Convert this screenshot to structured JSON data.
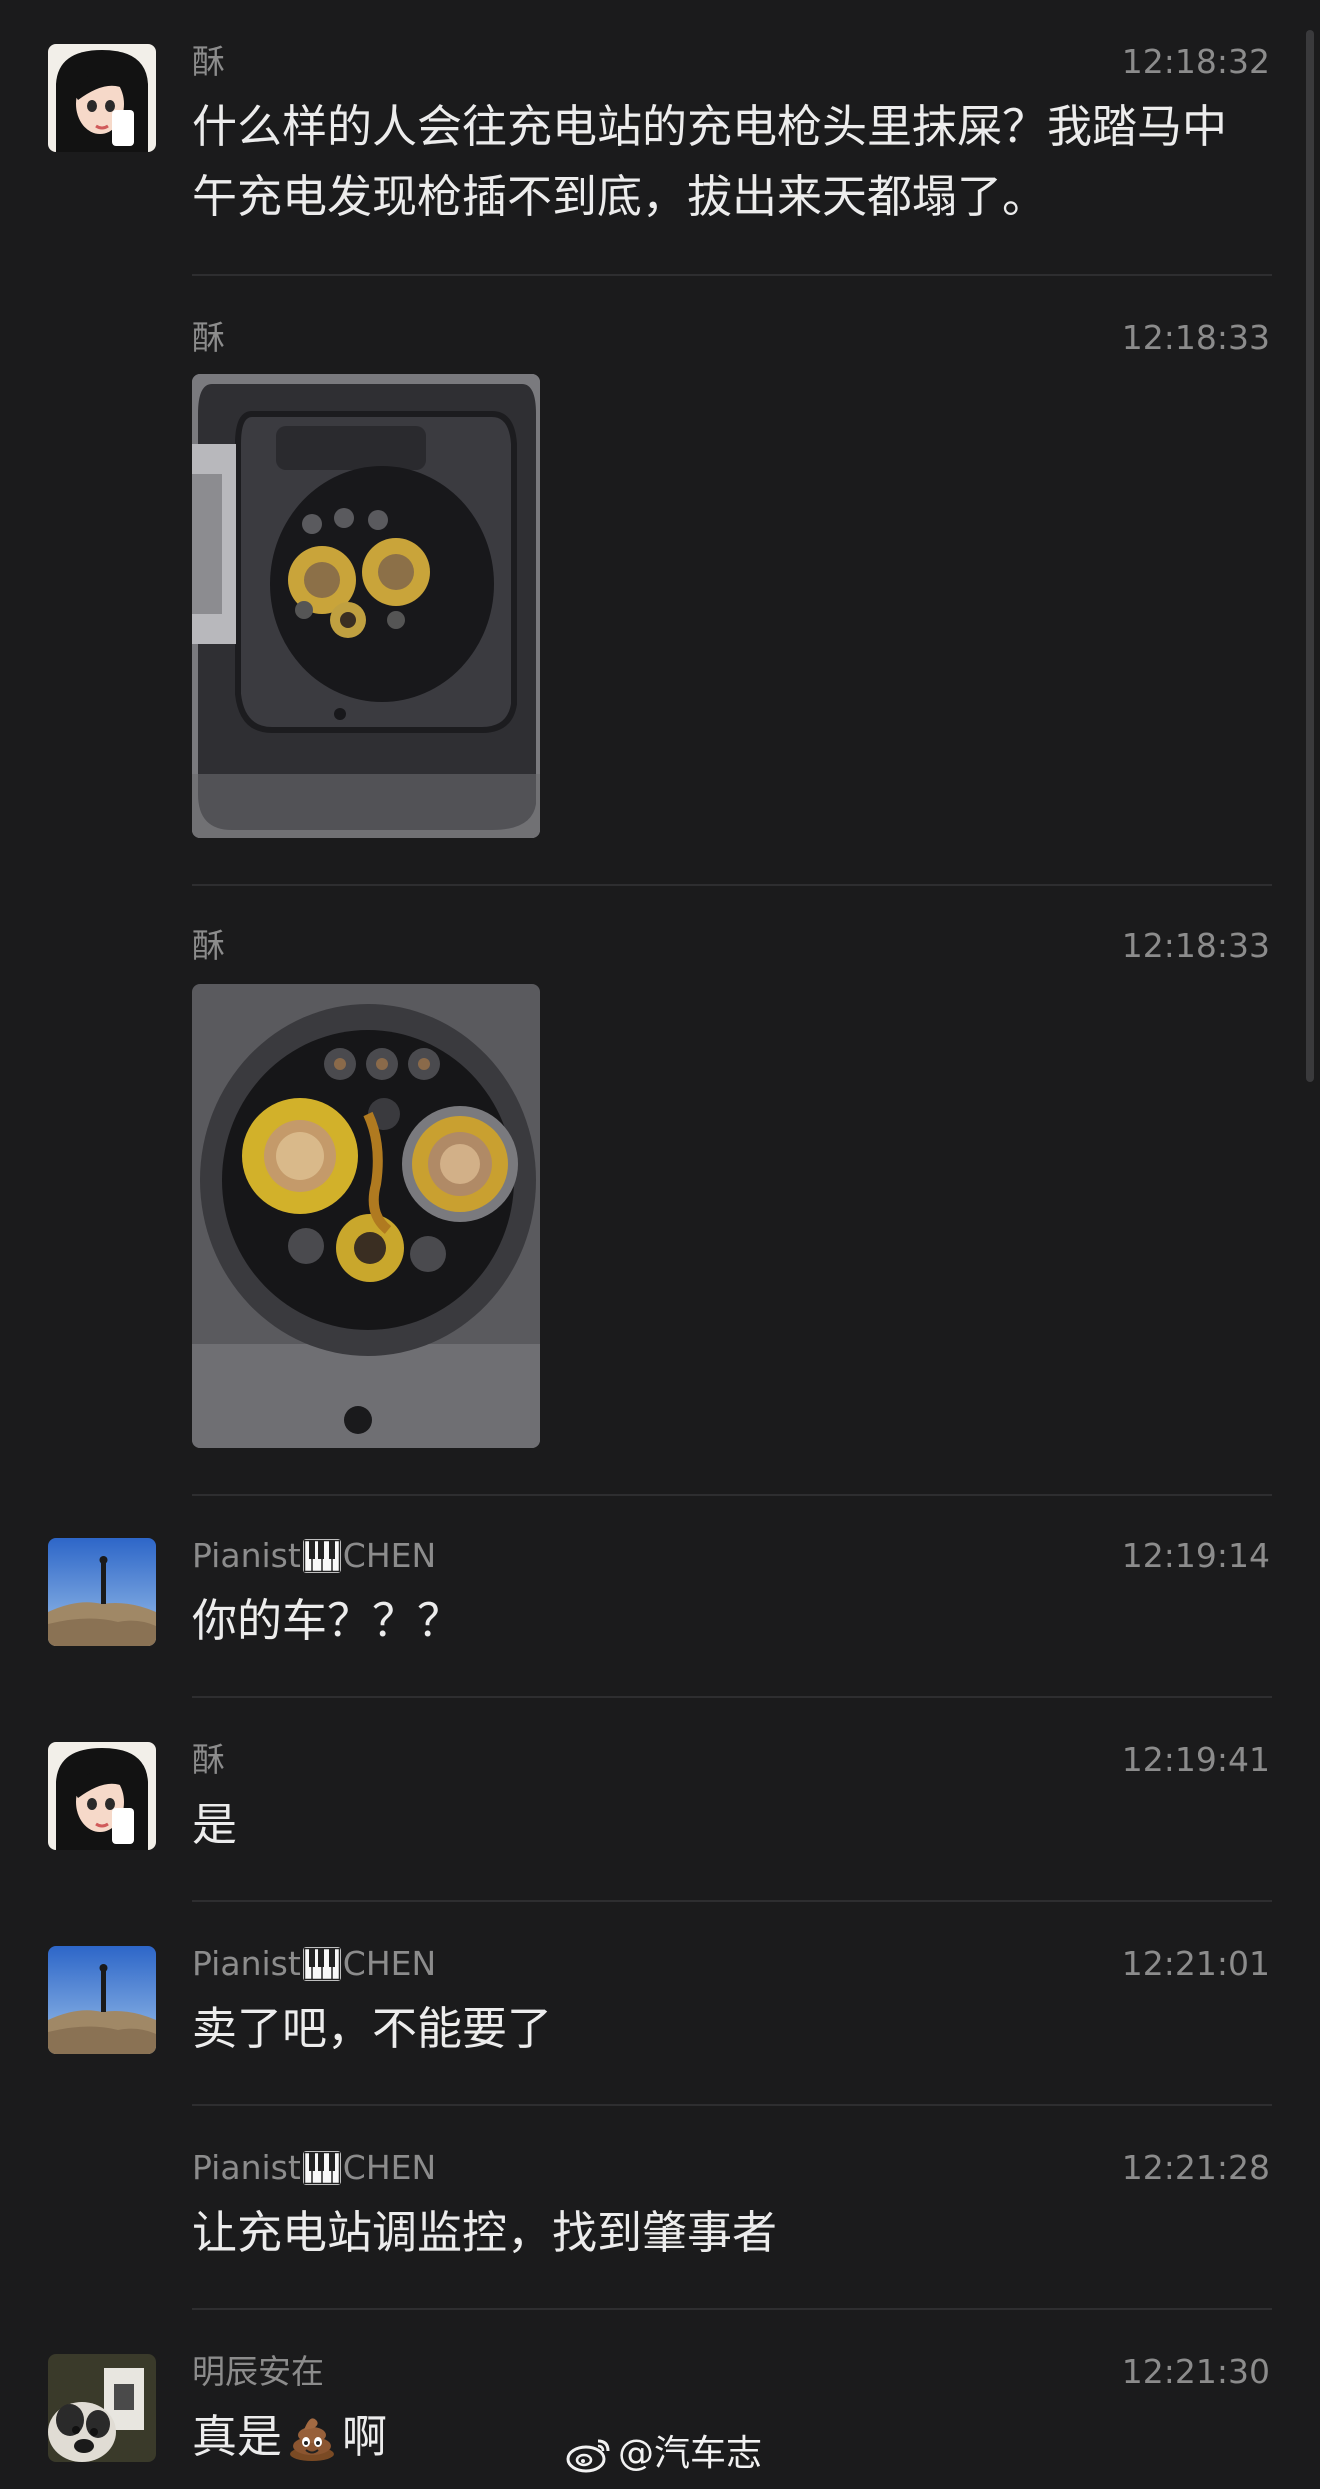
{
  "messages": [
    {
      "sender": "酥",
      "time": "12:18:32",
      "text": "什么样的人会往充电站的充电枪头里抹屎？我踏马中午充电发现枪插不到底，拔出来天都塌了。"
    },
    {
      "sender": "酥",
      "time": "12:18:33"
    },
    {
      "sender": "酥",
      "time": "12:18:33"
    },
    {
      "sender": "Pianist",
      "sender_suffix": "CHEN",
      "time": "12:19:14",
      "text": "你的车？？？"
    },
    {
      "sender": "酥",
      "time": "12:19:41",
      "text": "是"
    },
    {
      "sender": "Pianist",
      "sender_suffix": "CHEN",
      "time": "12:21:01",
      "text": "卖了吧，不能要了"
    },
    {
      "sender": "Pianist",
      "sender_suffix": "CHEN",
      "time": "12:21:28",
      "text": "让充电站调监控，找到肇事者"
    },
    {
      "sender": "明辰安在",
      "time": "12:21:30",
      "text_before": "真是",
      "text_after": "啊"
    }
  ],
  "watermark": "@汽车志",
  "icons": {
    "sender_emoji": "piano-keys-icon",
    "message_emoji": "pile-of-poo-icon",
    "watermark": "weibo-logo-icon"
  },
  "colors": {
    "background": "#1b1b1c",
    "text": "#ececec",
    "meta": "#8c8c8c",
    "divider": "#2e2e30"
  }
}
